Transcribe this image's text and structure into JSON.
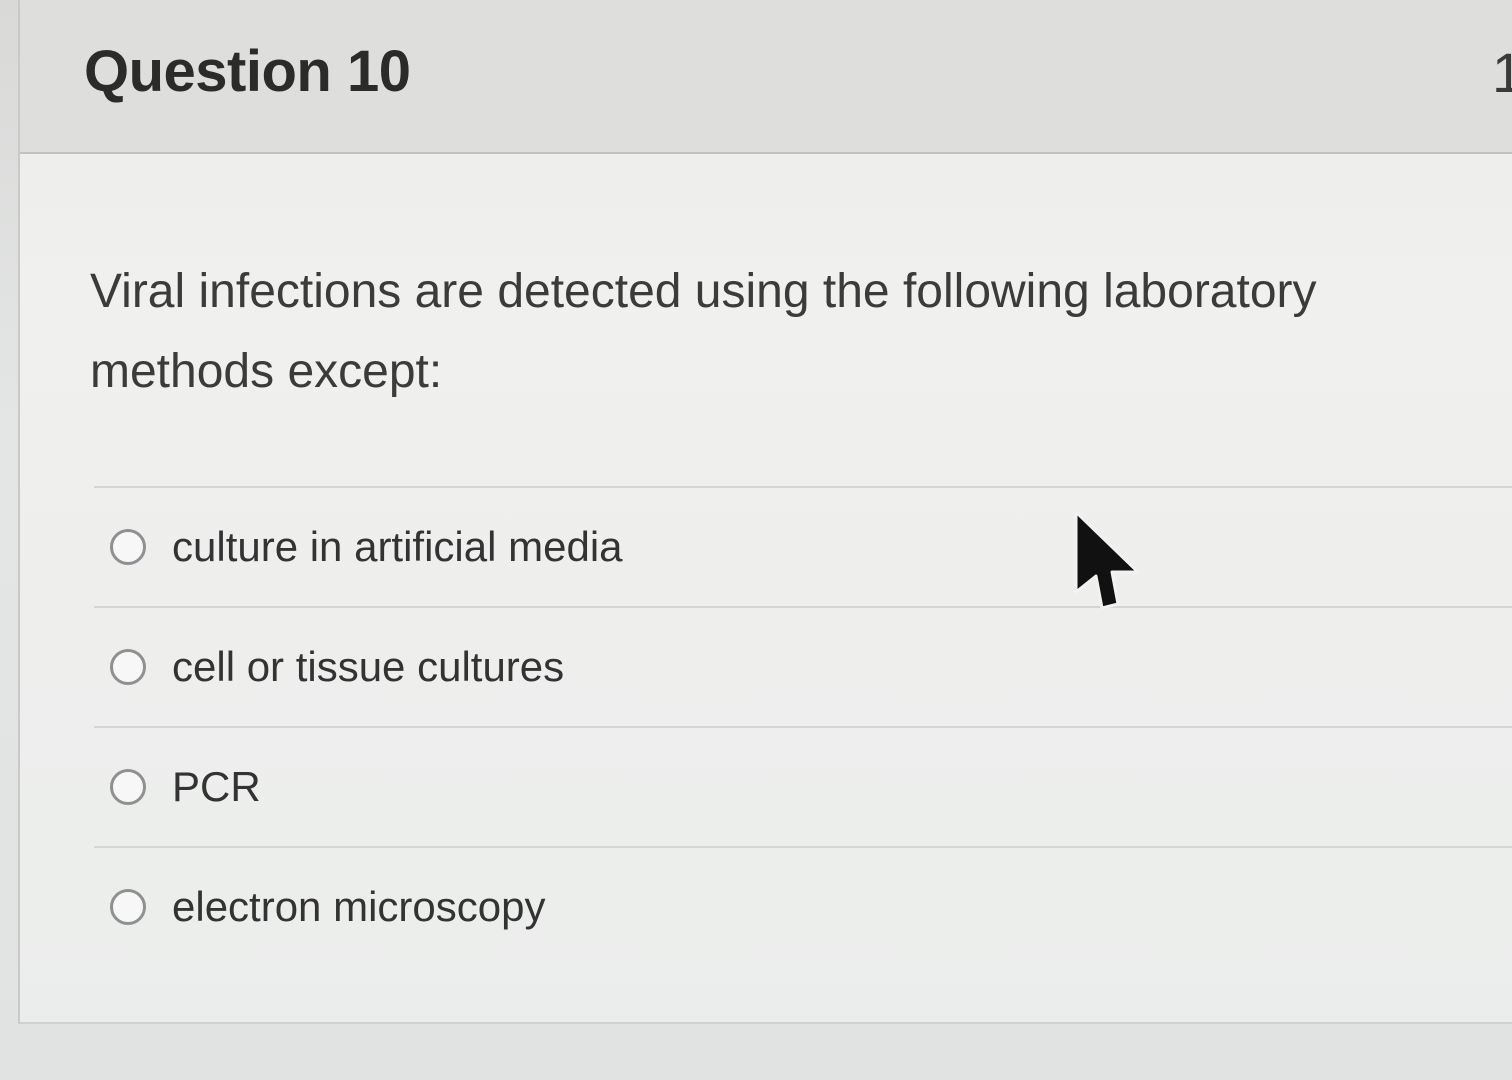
{
  "question": {
    "title": "Question 10",
    "points_partial": "1",
    "prompt": "Viral infections are detected using the following laboratory methods except:"
  },
  "answers": [
    {
      "label": "culture in artificial media",
      "selected": false
    },
    {
      "label": "cell or tissue cultures",
      "selected": false
    },
    {
      "label": "PCR",
      "selected": false
    },
    {
      "label": "electron microscopy",
      "selected": false
    }
  ],
  "cursor": {
    "icon": "mouse-pointer-icon"
  },
  "colors": {
    "header_bg": "#dededc",
    "body_bg": "#f0f0ee",
    "text": "#333333",
    "radio_border": "#8e9091"
  }
}
